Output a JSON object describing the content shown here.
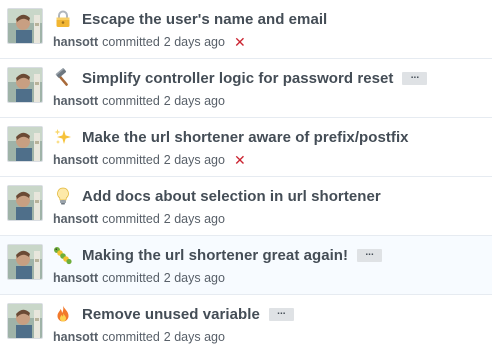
{
  "commits": [
    {
      "emoji_icon": "lock-icon",
      "title": "Escape the user's name and email",
      "author": "hansott",
      "action": "committed",
      "time": "2 days ago",
      "status": "failed",
      "status_glyph": "✕",
      "has_ellipsis": false
    },
    {
      "emoji_icon": "hammer-icon",
      "title": "Simplify controller logic for password reset",
      "author": "hansott",
      "action": "committed",
      "time": "2 days ago",
      "status": "none",
      "has_ellipsis": true,
      "ellipsis_label": "..."
    },
    {
      "emoji_icon": "sparkles-icon",
      "title": "Make the url shortener aware of prefix/postfix",
      "author": "hansott",
      "action": "committed",
      "time": "2 days ago",
      "status": "failed",
      "status_glyph": "✕",
      "has_ellipsis": false
    },
    {
      "emoji_icon": "light-bulb-icon",
      "title": "Add docs about selection in url shortener",
      "author": "hansott",
      "action": "committed",
      "time": "2 days ago",
      "status": "none",
      "has_ellipsis": false
    },
    {
      "emoji_icon": "caterpillar-icon",
      "title": "Making the url shortener great again!",
      "author": "hansott",
      "action": "committed",
      "time": "2 days ago",
      "status": "none",
      "has_ellipsis": true,
      "ellipsis_label": "..."
    },
    {
      "emoji_icon": "fire-icon",
      "title": "Remove unused variable",
      "author": "hansott",
      "action": "committed",
      "time": "2 days ago",
      "status": "none",
      "has_ellipsis": true,
      "ellipsis_label": "..."
    }
  ],
  "colors": {
    "failed": "#cb2431",
    "title": "#444d56",
    "meta": "#586069",
    "highlight_row_bg": "#f7fbff"
  }
}
